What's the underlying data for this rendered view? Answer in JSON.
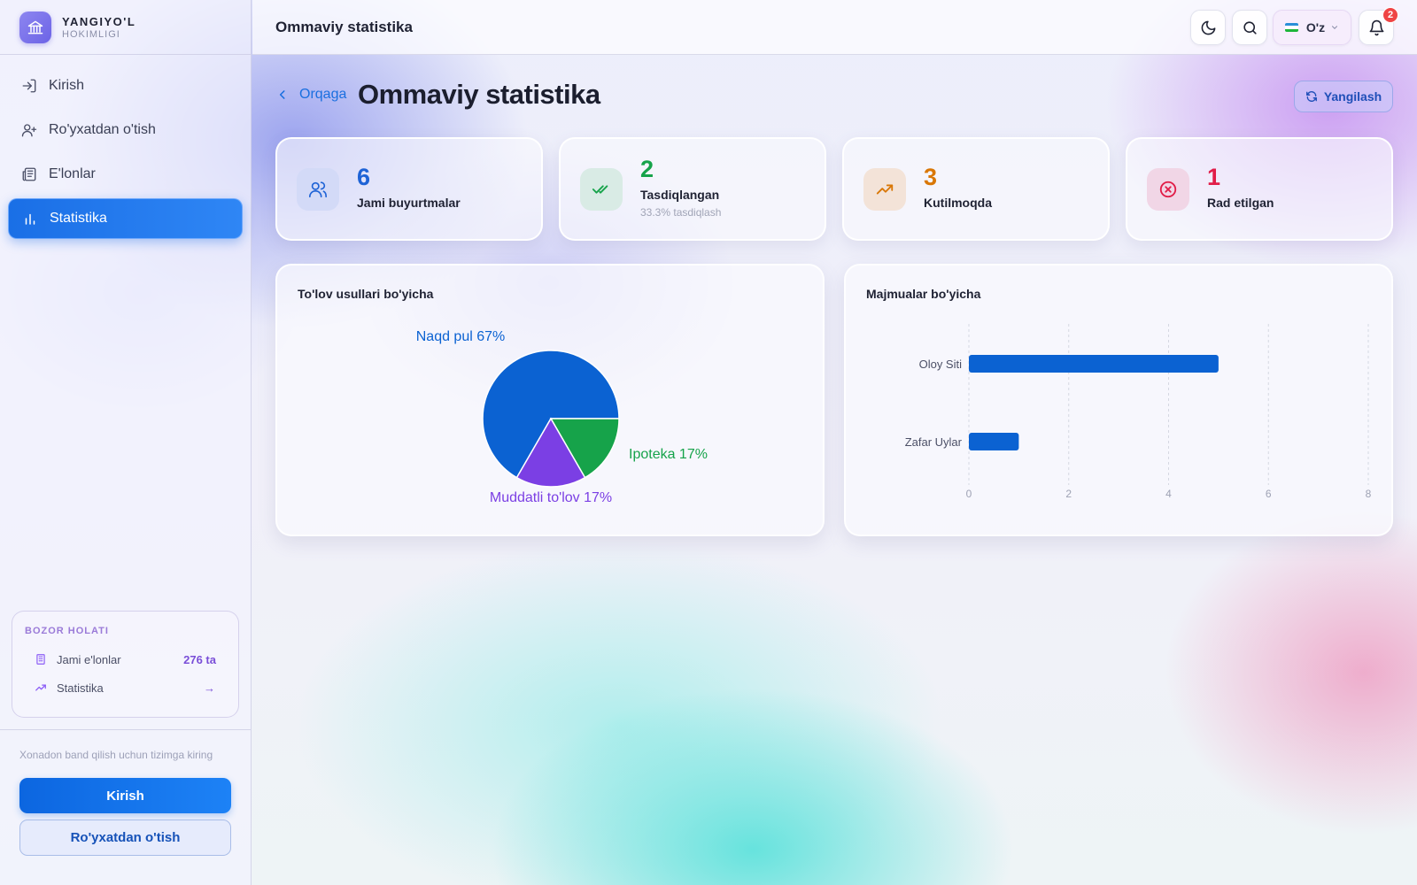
{
  "brand": {
    "title": "YANGIYO'L",
    "subtitle": "HOKIMLIGI"
  },
  "nav": [
    {
      "label": "Kirish",
      "icon": "login-icon"
    },
    {
      "label": "Ro'yxatdan o'tish",
      "icon": "user-plus-icon"
    },
    {
      "label": "E'lonlar",
      "icon": "newspaper-icon"
    },
    {
      "label": "Statistika",
      "icon": "bar-chart-icon",
      "active": true
    }
  ],
  "market": {
    "title": "BOZOR HOLATI",
    "total_label": "Jami e'lonlar",
    "total_value": "276 ta",
    "stats_label": "Statistika",
    "stats_arrow": "→"
  },
  "footer": {
    "hint": "Xonadon band qilish uchun tizimga kiring",
    "login_label": "Kirish",
    "register_label": "Ro'yxatdan o'tish"
  },
  "topbar": {
    "title": "Ommaviy statistika",
    "language": "O'z",
    "notification_count": "2"
  },
  "header": {
    "back_label": "Orqaga",
    "title": "Ommaviy statistika",
    "refresh_label": "Yangilash"
  },
  "stats": [
    {
      "value": "6",
      "label": "Jami buyurtmalar",
      "sub": "",
      "color": "#1e63d6",
      "bg": "#dde3fb",
      "icon": "users-icon"
    },
    {
      "value": "2",
      "label": "Tasdiqlangan",
      "sub": "33.3% tasdiqlash",
      "color": "#16a34a",
      "bg": "#dfeee8",
      "icon": "check-double-icon"
    },
    {
      "value": "3",
      "label": "Kutilmoqda",
      "sub": "",
      "color": "#d97706",
      "bg": "#f6e7dc",
      "icon": "trending-up-icon"
    },
    {
      "value": "1",
      "label": "Rad etilgan",
      "sub": "",
      "color": "#e11d48",
      "bg": "#f5dcea",
      "icon": "x-circle-icon"
    }
  ],
  "payment_panel": {
    "title": "To'lov usullari bo'yicha"
  },
  "complex_panel": {
    "title": "Majmualar bo'yicha"
  },
  "chart_data": [
    {
      "type": "pie",
      "title": "To'lov usullari bo'yicha",
      "slices": [
        {
          "label": "Naqd pul",
          "percent_label": "Naqd pul 67%",
          "value": 4,
          "color": "#0b62d2"
        },
        {
          "label": "Ipoteka",
          "percent_label": "Ipoteka 17%",
          "value": 1,
          "color": "#16a34a"
        },
        {
          "label": "Muddatli to'lov",
          "percent_label": "Muddatli to'lov 17%",
          "value": 1,
          "color": "#7b3fe4"
        }
      ]
    },
    {
      "type": "bar",
      "orientation": "horizontal",
      "title": "Majmualar bo'yicha",
      "categories": [
        "Oloy Siti",
        "Zafar Uylar"
      ],
      "values": [
        5,
        1
      ],
      "xlim": [
        0,
        8
      ],
      "xticks": [
        0,
        2,
        4,
        6,
        8
      ],
      "grid": true,
      "color": "#0b62d2"
    }
  ]
}
